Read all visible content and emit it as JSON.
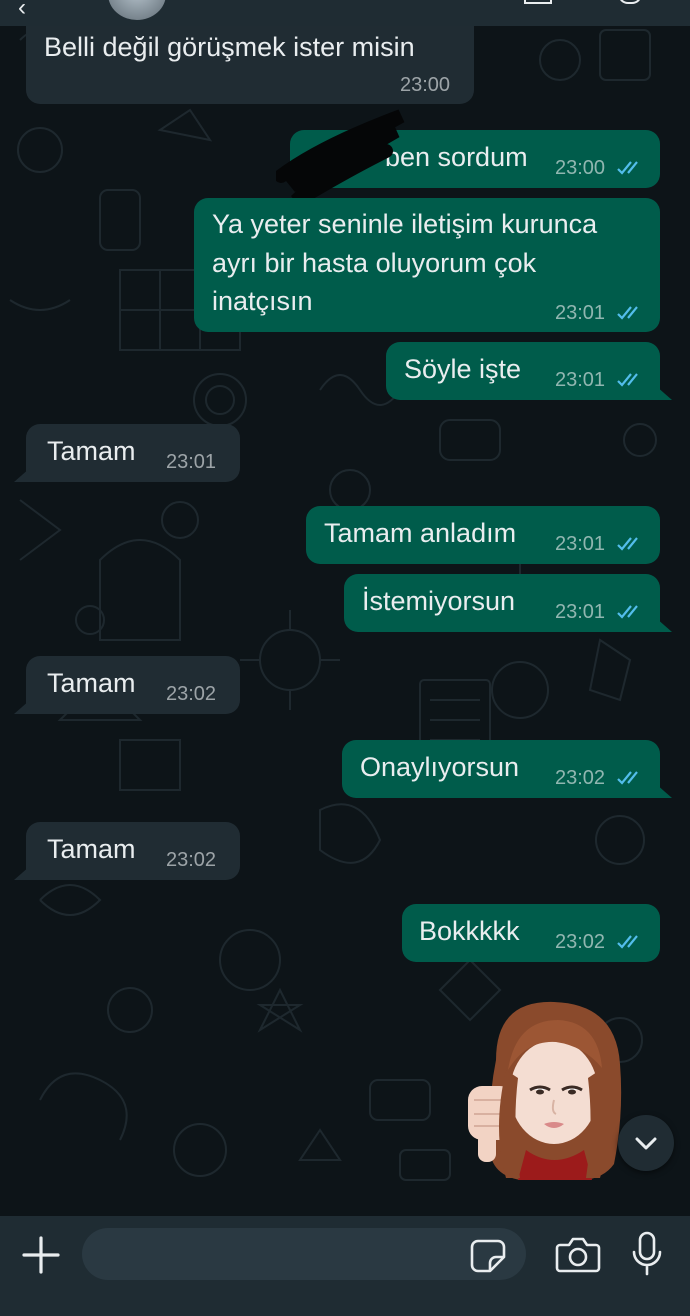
{
  "chat": {
    "messages": [
      {
        "id": "m1",
        "direction": "in",
        "text": "Belli değil görüşmek ister misin",
        "time": "23:00"
      },
      {
        "id": "m2",
        "direction": "out",
        "text": "ben sordum",
        "time": "23:00",
        "status": "read"
      },
      {
        "id": "m3",
        "direction": "out",
        "text": "Ya yeter seninle iletişim kurunca\nayrı bir hasta oluyorum çok\ninatçısın",
        "time": "23:01",
        "status": "read"
      },
      {
        "id": "m4",
        "direction": "out",
        "text": "Söyle işte",
        "time": "23:01",
        "status": "read"
      },
      {
        "id": "m5",
        "direction": "in",
        "text": "Tamam",
        "time": "23:01"
      },
      {
        "id": "m6",
        "direction": "out",
        "text": "Tamam anladım",
        "time": "23:01",
        "status": "read"
      },
      {
        "id": "m7",
        "direction": "out",
        "text": "İstemiyorsun",
        "time": "23:01",
        "status": "read"
      },
      {
        "id": "m8",
        "direction": "in",
        "text": "Tamam",
        "time": "23:02"
      },
      {
        "id": "m9",
        "direction": "out",
        "text": "Onaylıyorsun",
        "time": "23:02",
        "status": "read"
      },
      {
        "id": "m10",
        "direction": "in",
        "text": "Tamam",
        "time": "23:02"
      },
      {
        "id": "m11",
        "direction": "out",
        "text": "Bokkkkk",
        "time": "23:02",
        "status": "read"
      }
    ],
    "sticker": {
      "icon": "memoji-thumbs-down-sticker"
    }
  },
  "composer": {
    "value": "",
    "icons": {
      "attach": "plus-icon",
      "sticker": "sticker-icon",
      "camera": "camera-icon",
      "mic": "microphone-icon",
      "scroll": "chevron-down-icon"
    }
  },
  "colors": {
    "background": "#0d1418",
    "incoming_bubble": "#202c33",
    "outgoing_bubble": "#005c4b",
    "read_ticks": "#53bdeb",
    "text": "#e9edef",
    "input_bar": "#1f2c33"
  }
}
